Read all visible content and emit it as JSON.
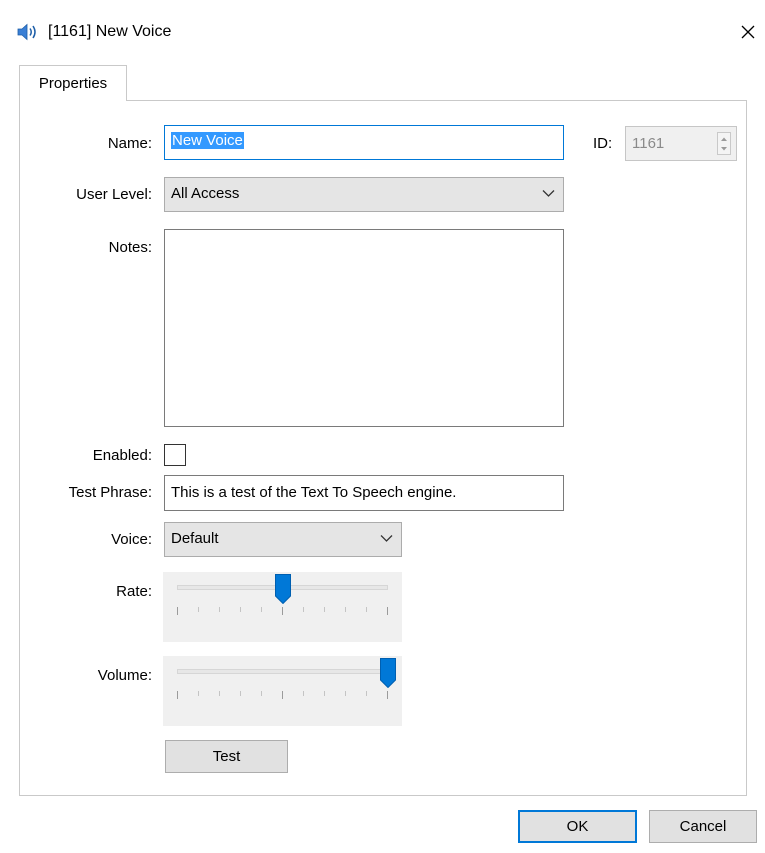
{
  "window": {
    "title": "[1161] New Voice",
    "icon": "speaker-icon",
    "close_icon": "close-icon"
  },
  "tabs": [
    {
      "label": "Properties",
      "selected": true
    }
  ],
  "form": {
    "name_label": "Name:",
    "name_value": "New Voice",
    "id_label": "ID:",
    "id_value": "1161",
    "user_level_label": "User Level:",
    "user_level_value": "All Access",
    "notes_label": "Notes:",
    "notes_value": "",
    "enabled_label": "Enabled:",
    "enabled_checked": false,
    "test_phrase_label": "Test Phrase:",
    "test_phrase_value": "This is a test of the Text To Speech engine.",
    "voice_label": "Voice:",
    "voice_value": "Default",
    "rate_label": "Rate:",
    "rate_level": 0.5,
    "volume_label": "Volume:",
    "volume_level": 1.0,
    "test_button": "Test"
  },
  "footer": {
    "ok_label": "OK",
    "cancel_label": "Cancel"
  },
  "colors": {
    "accent": "#0078d7",
    "selection": "#3399ff"
  }
}
